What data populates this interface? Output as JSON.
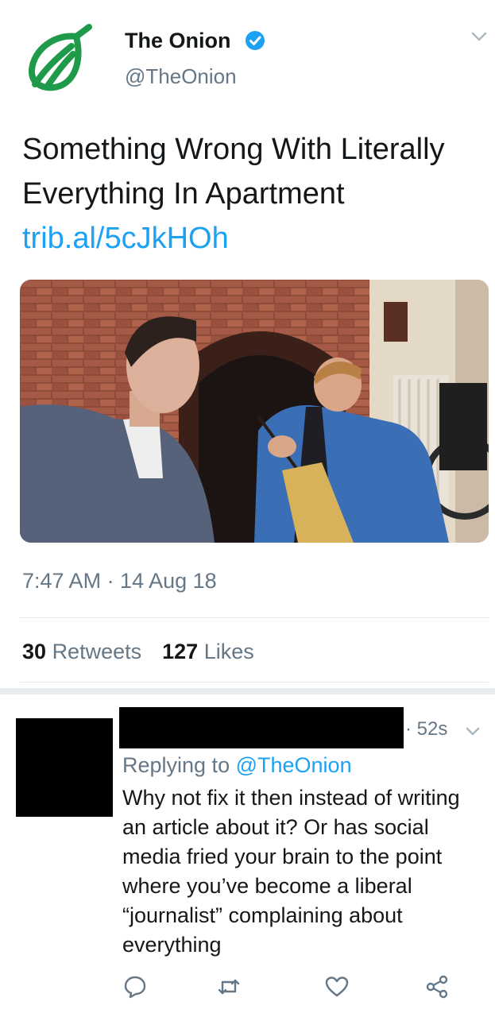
{
  "tweet": {
    "author_name": "The Onion",
    "author_handle": "@TheOnion",
    "text": "Something Wrong With Literally Everything In Apartment",
    "link": "trib.al/5cJkHOh",
    "timestamp": "7:47 AM · 14 Aug 18",
    "retweet_count": "30",
    "retweet_label": "Retweets",
    "like_count": "127",
    "like_label": "Likes"
  },
  "reply": {
    "time": "· 52s",
    "replying_prefix": "Replying to",
    "replying_handle": "@TheOnion",
    "text": "Why not fix it then instead of writing an article about it? Or has social media fried your brain to the point where you’ve become a liberal “journalist” complaining about everything"
  },
  "colors": {
    "brand_green": "#1f9a4a",
    "link_blue": "#1da1f2",
    "muted_gray": "#657786"
  },
  "icons": [
    "onion-logo-icon",
    "verified-badge-icon",
    "chevron-down-icon",
    "reply-icon",
    "retweet-icon",
    "like-icon",
    "share-icon"
  ]
}
